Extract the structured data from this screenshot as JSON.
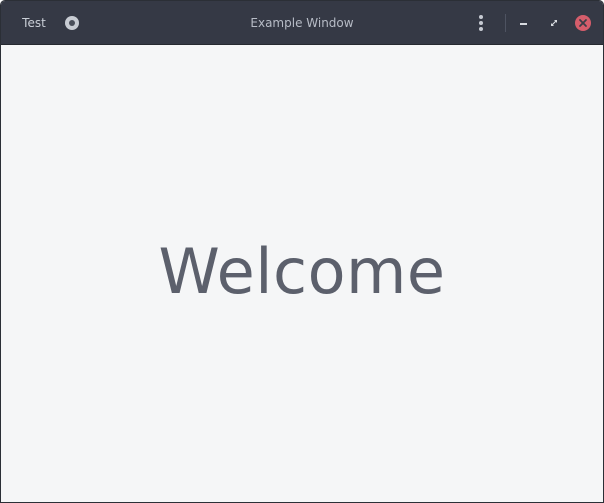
{
  "window": {
    "title": "Example Window"
  },
  "headerbar": {
    "test_button_label": "Test",
    "icons": {
      "toggle": "record-toggle-icon",
      "menu": "more-vertical-icon",
      "minimize": "minimize-icon",
      "maximize": "maximize-icon",
      "close": "close-icon"
    }
  },
  "content": {
    "welcome_text": "Welcome"
  },
  "colors": {
    "headerbar": "#353945",
    "content_background": "#f5f6f7",
    "welcome_text": "#5c606c",
    "close_button": "#d55d6b"
  }
}
